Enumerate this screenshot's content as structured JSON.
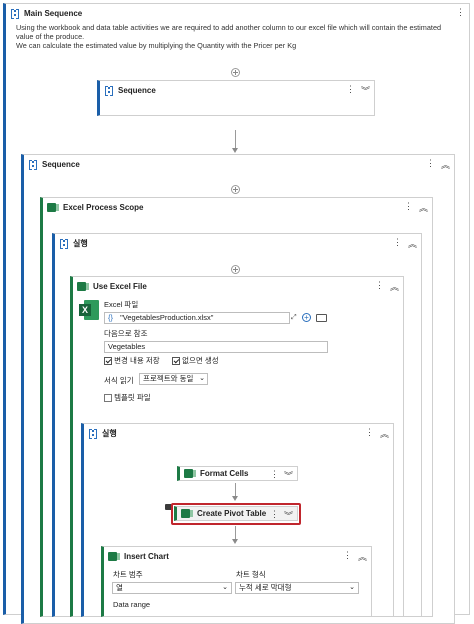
{
  "main": {
    "title": "Main Sequence",
    "description": "Using the workbook and data table activities we are required to add another column to our excel file which will contain the estimated value of the produce.",
    "description2": "We can calculate the estimated value by multiplying the Quantity with the Pricer per Kg"
  },
  "inner_sequence": {
    "title": "Sequence"
  },
  "sequence2": {
    "title": "Sequence"
  },
  "excel_scope": {
    "title": "Excel Process Scope"
  },
  "do1": {
    "title": "실행"
  },
  "use_excel": {
    "title": "Use Excel File",
    "file_label": "Excel 파일",
    "file_value": "\"VegetablesProduction.xlsx\"",
    "file_prefix": "{}",
    "ref_label": "다음으로 참조",
    "ref_value": "Vegetables",
    "save_changes_label": "변경 내용 저장",
    "save_changes_checked": true,
    "create_if_missing_label": "없으면 생성",
    "create_if_missing_checked": true,
    "read_format_label": "서식 읽기",
    "read_format_value": "프로젝트와 동일",
    "template_label": "템플릿 파일",
    "template_checked": false
  },
  "do2": {
    "title": "실행"
  },
  "format_cells": {
    "title": "Format Cells"
  },
  "pivot": {
    "title": "Create Pivot Table"
  },
  "insert_chart": {
    "title": "Insert Chart",
    "category_label": "차트 범주",
    "category_value": "열",
    "type_label": "차트 형식",
    "type_value": "누적 세로 막대형",
    "data_range_label": "Data range"
  },
  "icons": {
    "more": "⋮",
    "collapse": "︽",
    "expand": "︾"
  },
  "colors": {
    "sequence": "#1a5ea8",
    "excel": "#1d7a45",
    "highlight": "#c0262d"
  }
}
